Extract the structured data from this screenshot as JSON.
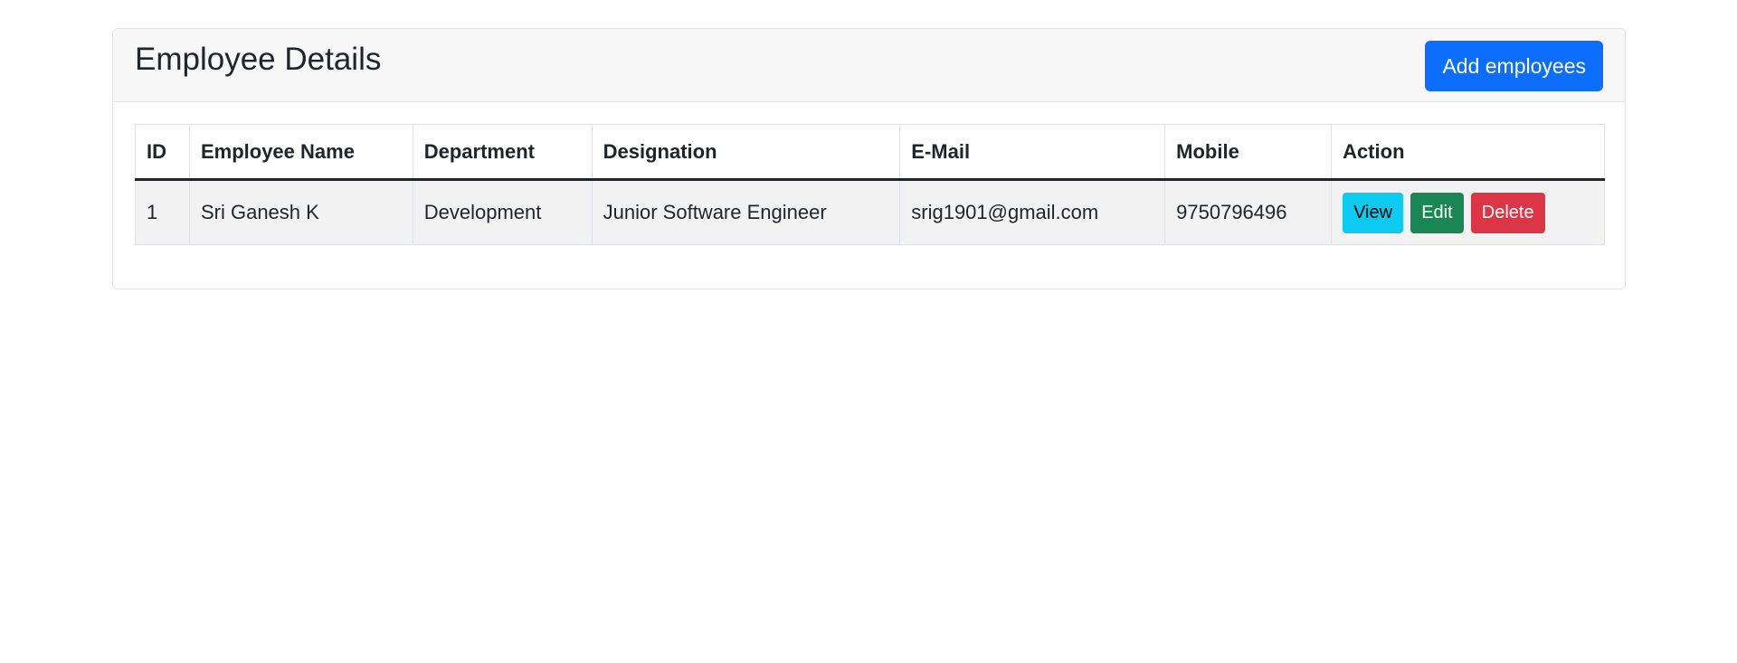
{
  "card": {
    "title": "Employee Details",
    "add_button_label": "Add employees"
  },
  "colors": {
    "primary": "#0d6efd",
    "info": "#0dcaf0",
    "success": "#198754",
    "danger": "#dc3545"
  },
  "table": {
    "headers": [
      "ID",
      "Employee Name",
      "Department",
      "Designation",
      "E-Mail",
      "Mobile",
      "Action"
    ],
    "rows": [
      {
        "id": "1",
        "name": "Sri Ganesh K",
        "department": "Development",
        "designation": "Junior Software Engineer",
        "email": "srig1901@gmail.com",
        "mobile": "9750796496",
        "actions": {
          "view": "View",
          "edit": "Edit",
          "delete": "Delete"
        }
      }
    ]
  }
}
